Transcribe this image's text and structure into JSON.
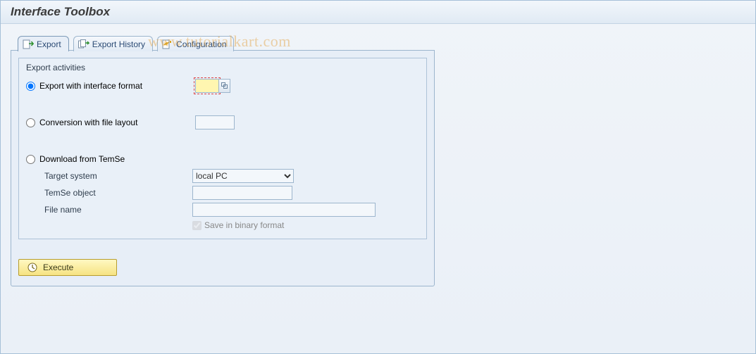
{
  "window": {
    "title": "Interface Toolbox"
  },
  "tabs": [
    {
      "key": "export",
      "label": "Export",
      "active": true
    },
    {
      "key": "history",
      "label": "Export History",
      "active": false
    },
    {
      "key": "config",
      "label": "Configuration",
      "active": false
    }
  ],
  "group": {
    "title": "Export activities",
    "options": {
      "export_interface": {
        "label": "Export with interface format",
        "selected": true,
        "value": ""
      },
      "conversion": {
        "label": "Conversion with file layout",
        "selected": false,
        "value": ""
      },
      "download_temse": {
        "label": "Download from TemSe",
        "selected": false
      }
    },
    "temse": {
      "target_system_label": "Target system",
      "target_system_value": "local PC",
      "target_system_options": [
        "local PC"
      ],
      "temse_object_label": "TemSe object",
      "temse_object_value": "",
      "file_name_label": "File name",
      "file_name_value": "",
      "binary_label": "Save in binary format",
      "binary_checked": true
    }
  },
  "buttons": {
    "execute": "Execute"
  },
  "watermark": "www.tutorialkart.com"
}
